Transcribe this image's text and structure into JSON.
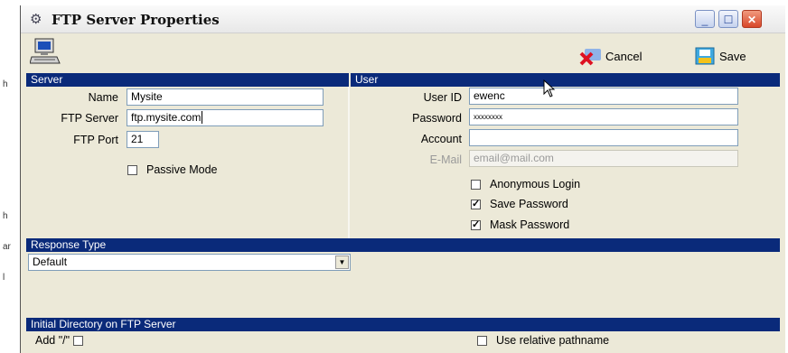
{
  "window": {
    "title": "FTP Server Properties",
    "buttons": {
      "minimize": "_",
      "maximize": "☐",
      "close": "✕"
    }
  },
  "toolbar": {
    "cancel_label": "Cancel",
    "save_label": "Save"
  },
  "server": {
    "header": "Server",
    "name_label": "Name",
    "name_value": "Mysite",
    "ftp_server_label": "FTP Server",
    "ftp_server_value": "ftp.mysite.com",
    "ftp_port_label": "FTP Port",
    "ftp_port_value": "21",
    "passive_mode_label": "Passive Mode",
    "passive_mode_checked": false
  },
  "user": {
    "header": "User",
    "user_id_label": "User ID",
    "user_id_value": "ewenc",
    "password_label": "Password",
    "password_value": "xxxxxxxx",
    "account_label": "Account",
    "account_value": "",
    "email_label": "E-Mail",
    "email_placeholder": "email@mail.com",
    "anonymous_login_label": "Anonymous Login",
    "anonymous_login_checked": false,
    "save_password_label": "Save Password",
    "save_password_checked": true,
    "mask_password_label": "Mask Password",
    "mask_password_checked": true
  },
  "response": {
    "header": "Response Type",
    "selected": "Default"
  },
  "initial_dir": {
    "header": "Initial Directory on FTP Server",
    "add_slash_label": "Add \"/\"",
    "add_slash_checked": false,
    "use_relative_label": "Use relative pathname",
    "use_relative_checked": false
  },
  "background_marks": [
    "h",
    "h",
    "ar",
    "l"
  ],
  "colors": {
    "section_header": "#0a2a7a",
    "dialog_bg": "#ece9d8"
  }
}
